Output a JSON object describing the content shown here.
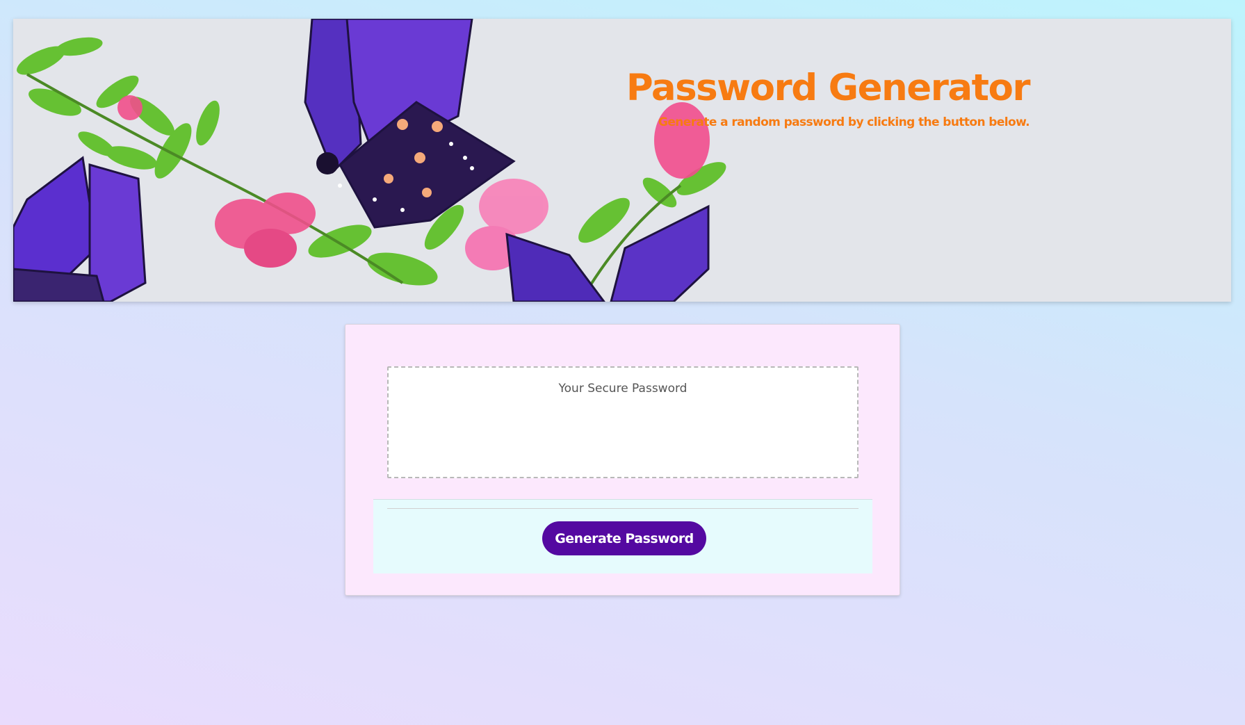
{
  "header": {
    "title": "Password Generator",
    "subtitle": "Generate a random password by clicking the button below."
  },
  "password": {
    "placeholder": "Your Secure Password",
    "value": ""
  },
  "actions": {
    "generate_label": "Generate Password"
  },
  "colors": {
    "accent_orange": "#f77b12",
    "button_purple": "#5409a1",
    "card_bg": "#fce8fd",
    "footer_bg": "#e6fbfd"
  }
}
